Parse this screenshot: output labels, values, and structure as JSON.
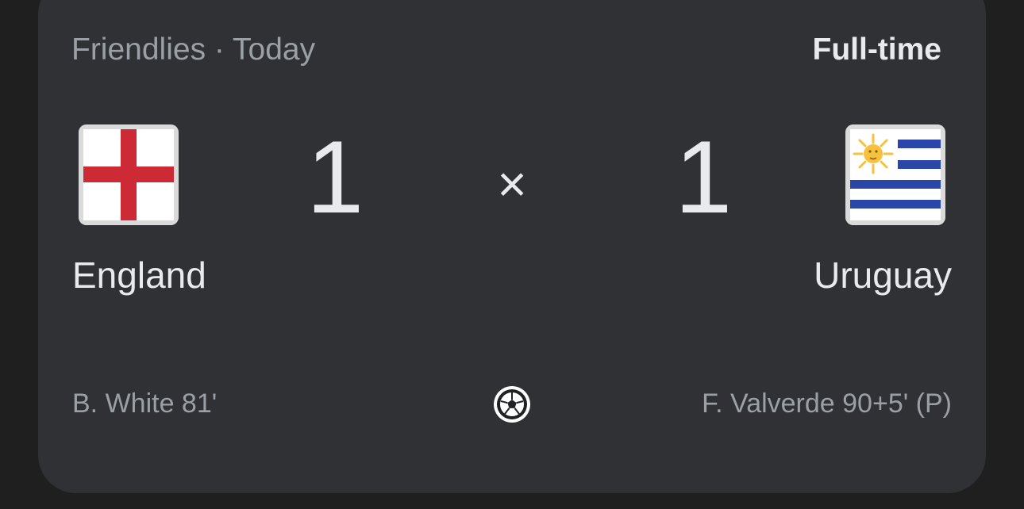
{
  "match": {
    "competition": "Friendlies · Today",
    "status": "Full-time",
    "separator": "×",
    "home": {
      "name": "England",
      "score": "1",
      "flag_icon": "england-flag-icon",
      "scorers": "B. White 81'"
    },
    "away": {
      "name": "Uruguay",
      "score": "1",
      "flag_icon": "uruguay-flag-icon",
      "scorers": "F. Valverde 90+5' (P)"
    },
    "goal_icon": "soccer-ball-icon"
  },
  "colors": {
    "background": "#1f1f1f",
    "card": "#303134",
    "primary_text": "#e8eaed",
    "secondary_text": "#9aa0a6",
    "england_red": "#cc2b36",
    "uruguay_blue": "#2a46a8",
    "uruguay_sun": "#f6c23d"
  }
}
